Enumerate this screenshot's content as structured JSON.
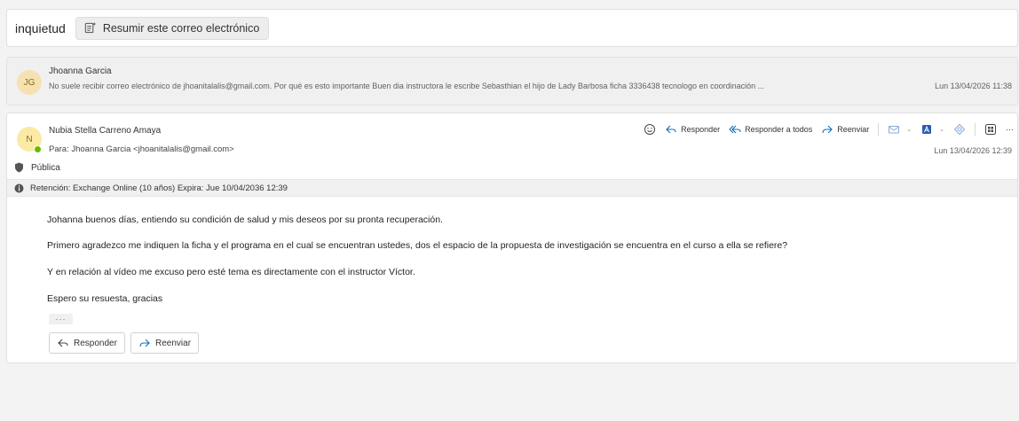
{
  "subject": {
    "title": "inquietud",
    "summarize_label": "Resumir este correo electrónico"
  },
  "previous_message": {
    "avatar_initials": "JG",
    "sender": "Jhoanna Garcia",
    "preview": "No suele recibir correo electrónico de jhoanitalalis@gmail.com. Por qué es esto importante Buen dia instructora le escribe Sebasthian el hijo de Lady Barbosa ficha 3336438 tecnologo en coordinación ...",
    "date": "Lun 13/04/2026 11:38"
  },
  "message": {
    "avatar_initials": "N",
    "sender": "Nubia Stella Carreno Amaya",
    "to": "Para: Jhoanna Garcia <jhoanitalalis@gmail.com>",
    "date": "Lun 13/04/2026 12:39",
    "sensitivity": "Pública",
    "retention": "Retención: Exchange Online (10 años) Expira: Jue 10/04/2036 12:39",
    "body": [
      "Johanna buenos días, entiendo su condición de salud y mis deseos por su pronta recuperación.",
      "Primero agradezco me indiquen la ficha y el programa en el cual se encuentran ustedes, dos  el espacio de la propuesta de investigación se encuentra en el curso a ella se refiere?",
      "Y en relación al vídeo me excuso pero esté tema es directamente con el instructor Víctor.",
      "Espero su resuesta, gracias"
    ],
    "more": "···"
  },
  "toolbar": {
    "reply": "Responder",
    "reply_all": "Responder a todos",
    "forward": "Reenviar",
    "more": "···"
  },
  "actions": {
    "reply": "Responder",
    "forward": "Reenviar"
  },
  "colors": {
    "accent": "#0f6cbd",
    "presence": "#6bb700",
    "avatar_bg": "#f6e1b0",
    "avatar_text": "#8a6a1d"
  }
}
